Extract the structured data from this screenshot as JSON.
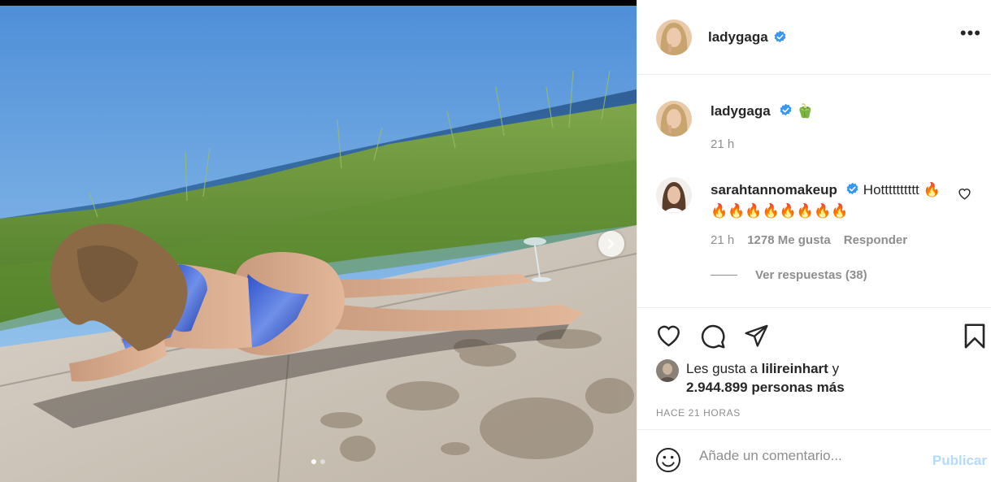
{
  "post": {
    "author": "ladygaga",
    "more_glyph": "•••",
    "caption_emoji": "🫑",
    "caption_time": "21 h",
    "comments": [
      {
        "user": "sarahtannomakeup",
        "text": "Hotttttttttt 🔥🔥🔥🔥🔥🔥🔥🔥🔥",
        "time": "21 h",
        "likes": "1278 Me gusta",
        "reply": "Responder",
        "view_replies": "Ver respuestas (38)"
      }
    ],
    "liked_by_prefix": "Les gusta a",
    "liked_by_user": "lilireinhart",
    "liked_by_and": "y",
    "liked_by_others": "2.944.899 personas más",
    "timestamp": "HACE 21 HORAS",
    "comment_placeholder": "Añade un comentario...",
    "post_label": "Publicar",
    "carousel": {
      "slides": 2,
      "active": 0
    }
  },
  "icons": [
    "verified-badge-icon",
    "more-options-icon",
    "heart-icon",
    "comment-icon",
    "share-icon",
    "bookmark-icon",
    "emoji-icon",
    "chevron-right-icon"
  ],
  "colors": {
    "verified": "#3897f0",
    "publish_disabled": "#b3dbff",
    "secondary_text": "#8e8e8e",
    "primary_text": "#262626"
  }
}
